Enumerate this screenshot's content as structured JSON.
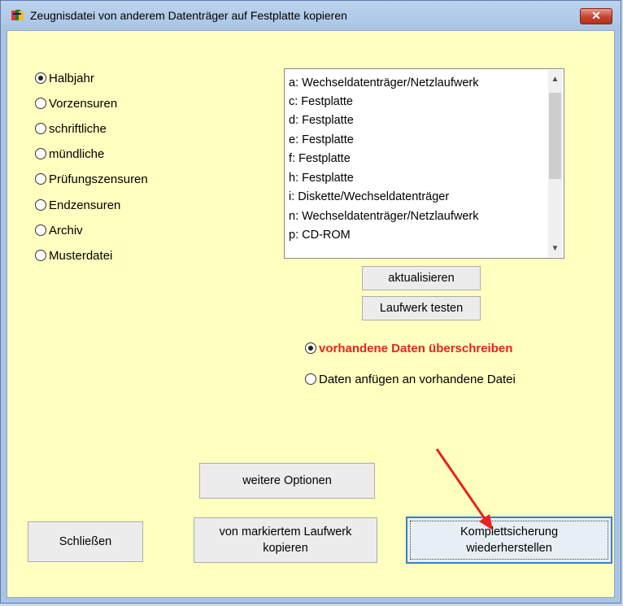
{
  "window": {
    "title": "Zeugnisdatei von  anderem Datenträger auf Festplatte kopieren",
    "close_label": "✕"
  },
  "left_options": [
    {
      "label": "Halbjahr",
      "checked": true
    },
    {
      "label": "Vorzensuren",
      "checked": false
    },
    {
      "label": "schriftliche",
      "checked": false
    },
    {
      "label": "mündliche",
      "checked": false
    },
    {
      "label": "Prüfungszensuren",
      "checked": false
    },
    {
      "label": "Endzensuren",
      "checked": false
    },
    {
      "label": "Archiv",
      "checked": false
    },
    {
      "label": "Musterdatei",
      "checked": false
    }
  ],
  "drives": [
    "a:  Wechseldatenträger/Netzlaufwerk",
    "c:  Festplatte",
    "d:  Festplatte",
    "e:  Festplatte",
    "f:  Festplatte",
    "h:  Festplatte",
    "i:  Diskette/Wechseldatenträger",
    "n:  Wechseldatenträger/Netzlaufwerk",
    "p:  CD-ROM"
  ],
  "buttons": {
    "refresh": "aktualisieren",
    "test_drive": "Laufwerk testen",
    "more_options": "weitere Optionen",
    "close": "Schließen",
    "copy_line1": "von markiertem Laufwerk",
    "copy_line2": "kopieren",
    "restore_line1": "Komplettsicherung",
    "restore_line2": "wiederherstellen"
  },
  "write_mode": {
    "overwrite": "vorhandene Daten überschreiben",
    "append": "Daten anfügen an vorhandene Datei",
    "selected": "overwrite"
  },
  "colors": {
    "client_bg": "#ffffc0",
    "accent_red": "#e8241c",
    "default_button_border": "#3a7fc0"
  }
}
